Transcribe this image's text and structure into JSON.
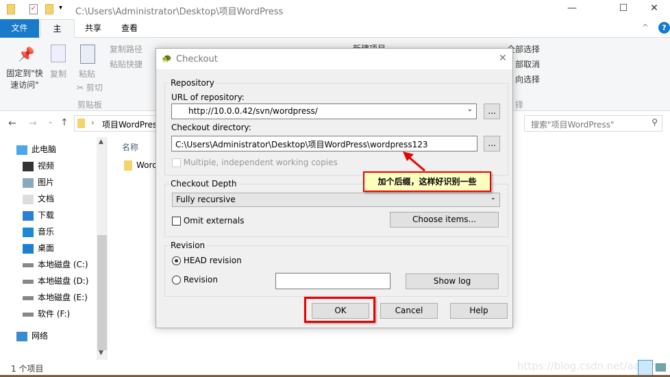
{
  "window": {
    "title": "C:\\Users\\Administrator\\Desktop\\项目WordPress"
  },
  "tabs": [
    {
      "label": "文件"
    },
    {
      "label": "主页"
    },
    {
      "label": "共享"
    },
    {
      "label": "查看"
    }
  ],
  "ribbon": {
    "pin": "固定到\"快速访问\"",
    "copy": "复制",
    "paste": "粘贴",
    "copy_path": "复制路径",
    "paste_shortcut": "粘贴快捷",
    "cut": "剪切",
    "clipboard_group": "剪贴板",
    "new_item": "新建项目",
    "select_all": "全部选择",
    "select_none": "部取消",
    "invert": "向选择",
    "select_group": "择"
  },
  "address": {
    "crumb": "项目WordPress",
    "search_placeholder": "搜索\"项目WordPress\""
  },
  "nav": [
    {
      "label": "此电脑",
      "icon": "computer-icon"
    },
    {
      "label": "视频",
      "icon": "video-icon"
    },
    {
      "label": "图片",
      "icon": "picture-icon"
    },
    {
      "label": "文档",
      "icon": "document-icon"
    },
    {
      "label": "下载",
      "icon": "download-icon"
    },
    {
      "label": "音乐",
      "icon": "music-icon"
    },
    {
      "label": "桌面",
      "icon": "desktop-icon"
    },
    {
      "label": "本地磁盘 (C:)",
      "icon": "drive-icon"
    },
    {
      "label": "本地磁盘 (D:)",
      "icon": "drive-icon"
    },
    {
      "label": "本地磁盘 (E:)",
      "icon": "drive-icon"
    },
    {
      "label": "软件 (F:)",
      "icon": "drive-icon"
    },
    {
      "label": "网络",
      "icon": "network-icon"
    }
  ],
  "filelist": {
    "header": "名称",
    "items": [
      "Word"
    ]
  },
  "status": {
    "count": "1 个项目"
  },
  "watermark": "https://blog.csdn.net/aaron",
  "dialog": {
    "title": "Checkout",
    "repository_group": "Repository",
    "url_label": "URL of repository:",
    "url_value": "http://10.0.0.42/svn/wordpress/",
    "dir_label": "Checkout directory:",
    "dir_value": "C:\\Users\\Administrator\\Desktop\\项目WordPress\\wordpress123",
    "browse": "...",
    "multiple_label": "Multiple, independent working copies",
    "depth_group": "Checkout Depth",
    "depth_value": "Fully recursive",
    "omit_label": "Omit externals",
    "choose_items": "Choose items...",
    "revision_group": "Revision",
    "head_label": "HEAD revision",
    "revision_label": "Revision",
    "revision_value": "",
    "show_log": "Show log",
    "ok": "OK",
    "cancel": "Cancel",
    "help": "Help"
  },
  "annotation": {
    "text": "加个后缀，这样好识别一些",
    "color": "#e00000"
  }
}
